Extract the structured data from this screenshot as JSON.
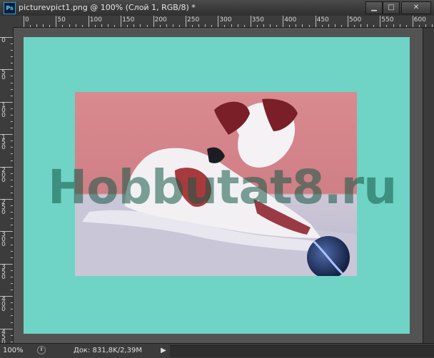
{
  "window": {
    "app_icon_label": "Ps",
    "title": "picturevpict1.png @ 100% (Слой 1, RGB/8) *",
    "min_glyph": "▁",
    "max_glyph": "□",
    "close_glyph": "✕"
  },
  "ruler_h_labels": [
    "0",
    "50",
    "100",
    "150",
    "200",
    "250",
    "300",
    "350",
    "400",
    "450",
    "500",
    "550",
    "600"
  ],
  "ruler_v_labels": [
    "0",
    "50",
    "100",
    "150",
    "200",
    "250",
    "300",
    "350",
    "400",
    "450"
  ],
  "canvas": {
    "background_color": "#6fd3c5",
    "watermark": "Hobbutat8.ru",
    "photo_description_icon": "dog-photo"
  },
  "status": {
    "zoom": "100%",
    "doc_info": "Док: 831,8K/2,39M",
    "arrow_glyph": "▶"
  }
}
